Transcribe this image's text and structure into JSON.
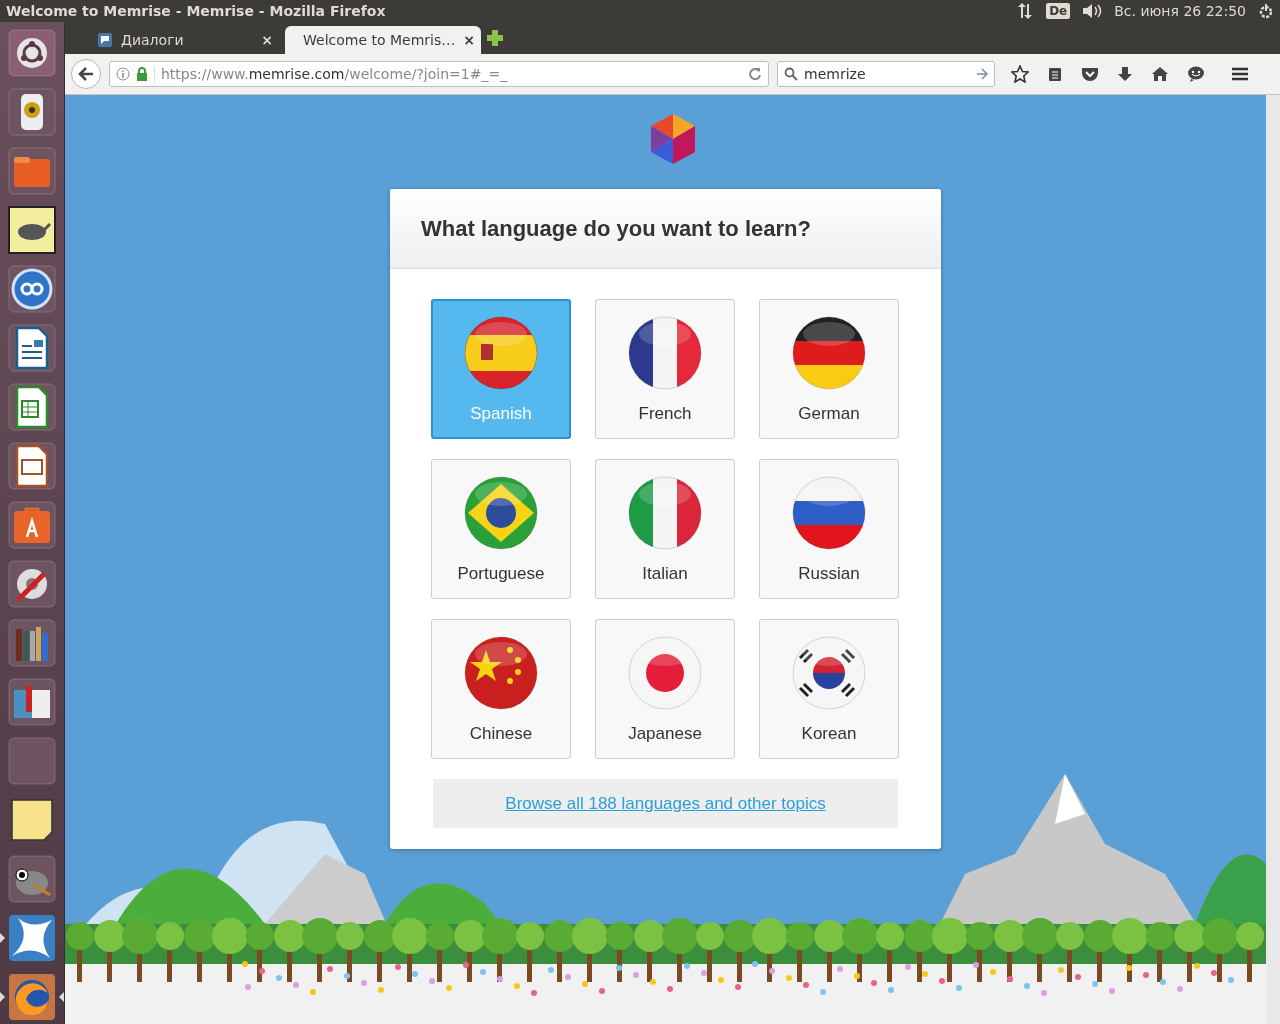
{
  "window": {
    "title": "Welcome to Memrise - Memrise - Mozilla Firefox"
  },
  "top_panel": {
    "keyboard_layout": "De",
    "clock": "Вс. июня 26 22:50"
  },
  "launcher": [
    {
      "running": false,
      "focused": false
    },
    {
      "running": false,
      "focused": false
    },
    {
      "running": false,
      "focused": false
    },
    {
      "running": false,
      "focused": false
    },
    {
      "running": false,
      "focused": false
    },
    {
      "running": false,
      "focused": false
    },
    {
      "running": false,
      "focused": false
    },
    {
      "running": false,
      "focused": false
    },
    {
      "running": false,
      "focused": false
    },
    {
      "running": false,
      "focused": false
    },
    {
      "running": false,
      "focused": false
    },
    {
      "running": false,
      "focused": false
    },
    {
      "running": false,
      "focused": false
    },
    {
      "running": false,
      "focused": false
    },
    {
      "running": false,
      "focused": false
    },
    {
      "running": true,
      "focused": false
    },
    {
      "running": true,
      "focused": true
    }
  ],
  "tabs": [
    {
      "label": "Диалоги",
      "close": "×",
      "selected": false
    },
    {
      "label": "Welcome to Memris…",
      "close": "×",
      "selected": true
    }
  ],
  "address_bar": {
    "url_parts": [
      "https://www.",
      "memrise.com",
      "/welcome/?join=1#_=_"
    ]
  },
  "search_field": {
    "value": "memrize"
  },
  "page": {
    "heading": "What language do you want to learn?",
    "languages": [
      {
        "label": "Spanish",
        "selected": true
      },
      {
        "label": "French",
        "selected": false
      },
      {
        "label": "German",
        "selected": false
      },
      {
        "label": "Portuguese",
        "selected": false
      },
      {
        "label": "Italian",
        "selected": false
      },
      {
        "label": "Russian",
        "selected": false
      },
      {
        "label": "Chinese",
        "selected": false
      },
      {
        "label": "Japanese",
        "selected": false
      },
      {
        "label": "Korean",
        "selected": false
      }
    ],
    "browse_link": "Browse all 188 languages and other topics"
  }
}
